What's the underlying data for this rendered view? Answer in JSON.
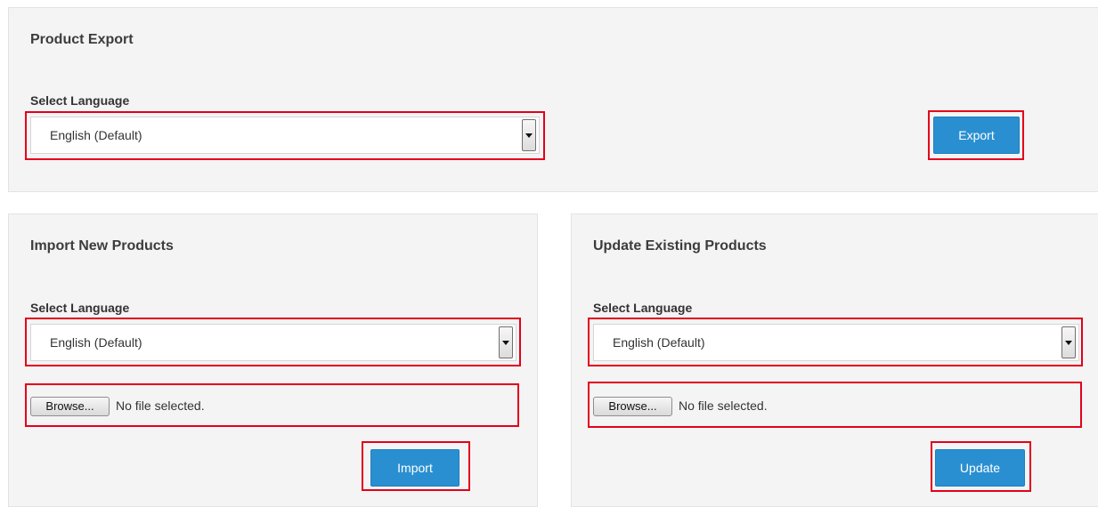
{
  "export_panel": {
    "title": "Product Export",
    "language_label": "Select Language",
    "language_value": "English (Default)",
    "button_label": "Export"
  },
  "import_panel": {
    "title": "Import New Products",
    "language_label": "Select Language",
    "language_value": "English (Default)",
    "browse_label": "Browse...",
    "file_status": "No file selected.",
    "button_label": "Import"
  },
  "update_panel": {
    "title": "Update Existing Products",
    "language_label": "Select Language",
    "language_value": "English (Default)",
    "browse_label": "Browse...",
    "file_status": "No file selected.",
    "button_label": "Update"
  },
  "colors": {
    "panel_bg": "#f4f4f4",
    "primary_button": "#2a8fd1",
    "highlight": "#e3001b"
  }
}
